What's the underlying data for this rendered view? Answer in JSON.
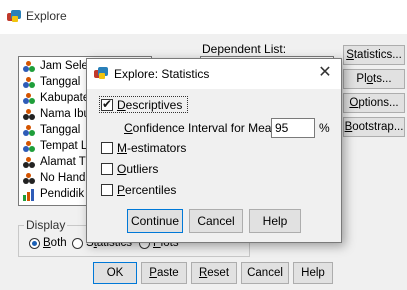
{
  "window": {
    "title": "Explore",
    "variables": [
      "Jam Sele",
      "Tanggal",
      "Kabupate",
      "Nama Ibu",
      "Tanggal",
      "Tempat L",
      "Alamat T",
      "No Hand",
      "Pendidik"
    ],
    "dependent_list_label": "Dependent List:",
    "side_buttons": [
      "Statistics...",
      "Plots...",
      "Options...",
      "Bootstrap..."
    ],
    "display": {
      "legend": "Display",
      "options": [
        "Both",
        "Statistics",
        "Plots"
      ],
      "selected": "Both"
    },
    "bottom_buttons": [
      "OK",
      "Paste",
      "Reset",
      "Cancel",
      "Help"
    ]
  },
  "dialog": {
    "title": "Explore: Statistics",
    "close_glyph": "✕",
    "descriptives_label": "Descriptives",
    "descriptives_checked": true,
    "ci_label": "Confidence Interval for Mean:",
    "ci_value": "95",
    "ci_unit": "%",
    "m_estimators_label": "M-estimators",
    "outliers_label": "Outliers",
    "percentiles_label": "Percentiles",
    "buttons": [
      "Continue",
      "Cancel",
      "Help"
    ]
  },
  "icons": {
    "app": "spss-app-icon",
    "person": "person-variable-icon",
    "bars": "ordinal-variable-icon"
  }
}
